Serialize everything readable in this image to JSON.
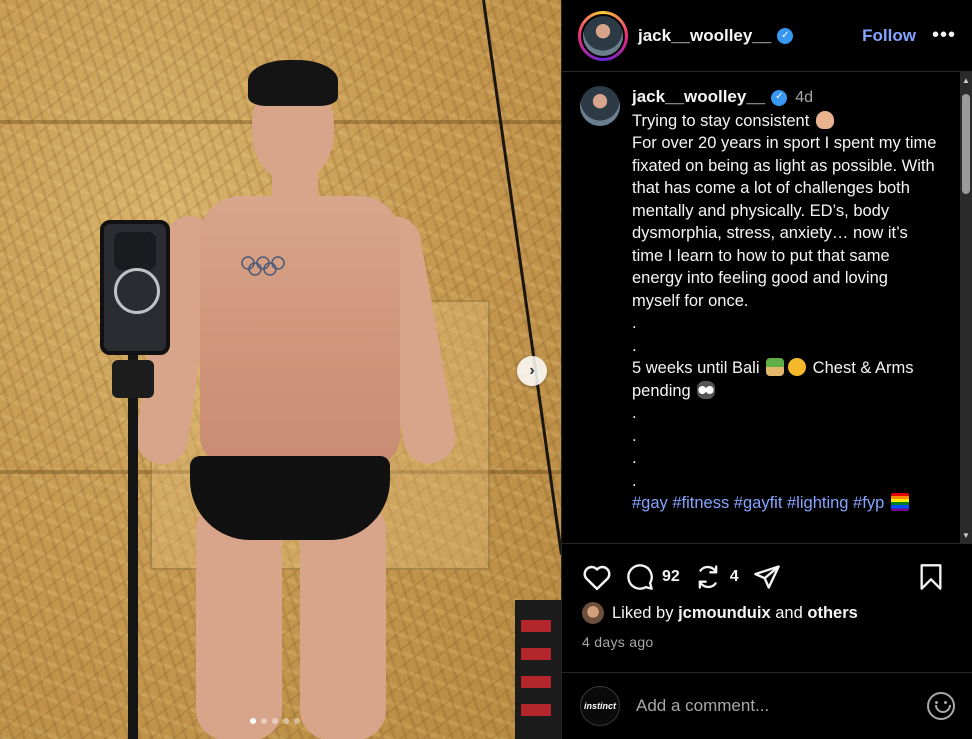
{
  "header": {
    "username": "jack__woolley__",
    "follow_label": "Follow",
    "more_icon": "more-horizontal-icon"
  },
  "caption": {
    "username": "jack__woolley__",
    "time": "4d",
    "lines": [
      "Trying to stay consistent",
      "For over 20 years in sport I spent my time fixated on being as light as possible. With that has come a lot of challenges both mentally and physically. ED’s, body dysmorphia, stress, anxiety… now it’s time I learn to how to put that same energy into feeling good and loving myself for once.",
      ".",
      ".",
      "5 weeks until Bali",
      "Chest & Arms pending",
      ".",
      ".",
      ".",
      "."
    ],
    "hashtags": "#gay #fitness #gayfit #lighting #fyp"
  },
  "actions": {
    "comment_count": "92",
    "repost_count": "4"
  },
  "likes": {
    "prefix": "Liked by",
    "user": "jcmounduix",
    "connector": "and",
    "others": "others"
  },
  "date": "4 days ago",
  "comment": {
    "avatar_text": "instinct",
    "placeholder": "Add a comment..."
  },
  "carousel": {
    "slide_count": 5,
    "active_index": 0
  },
  "colors": {
    "background": "#000000",
    "link": "#85a4ff",
    "muted": "#a8a8a8",
    "verified": "#3897f0"
  }
}
